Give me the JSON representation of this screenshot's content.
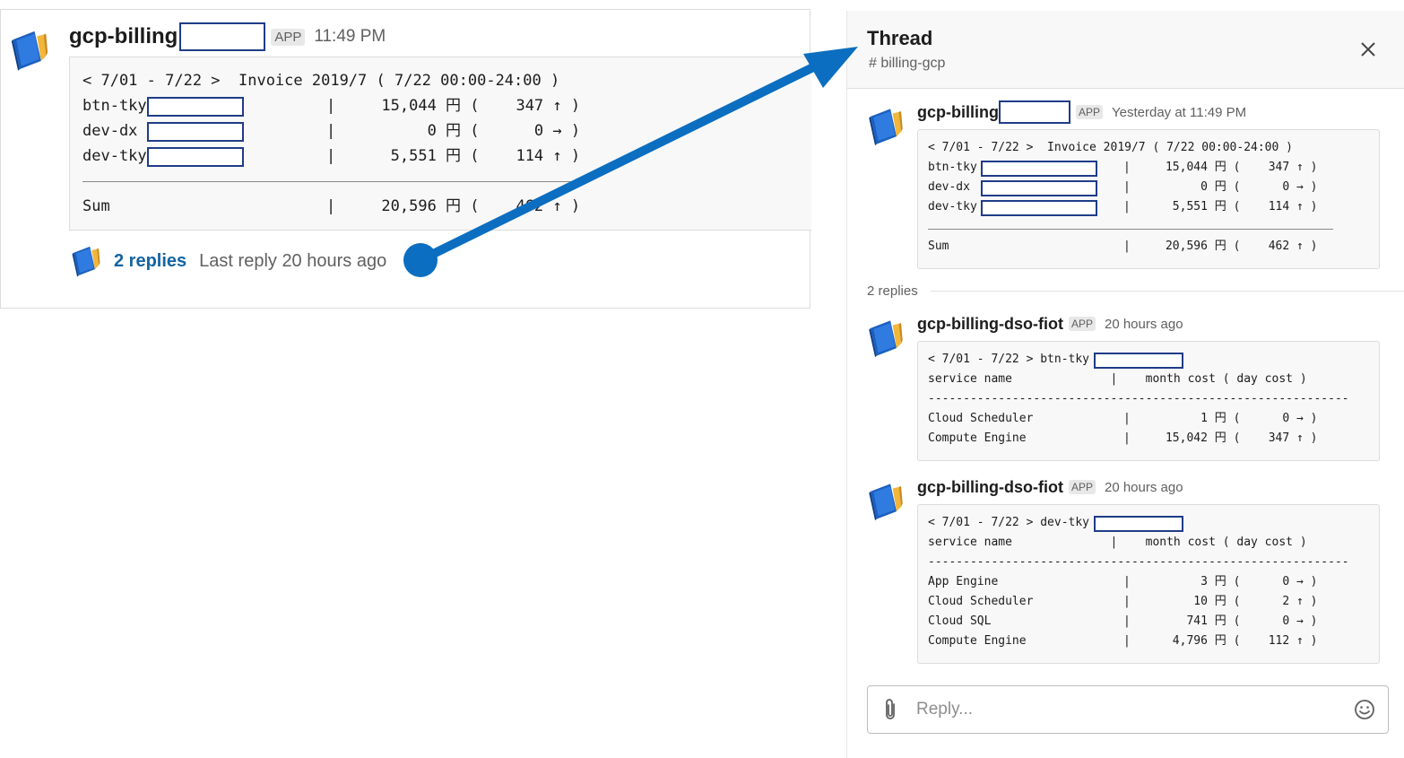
{
  "colors": {
    "accent_link": "#1264a3",
    "redaction_border": "#1f3c88",
    "annotation_arrow": "#0b6ec0"
  },
  "left_message": {
    "bot_name": "gcp-billing",
    "badge": "APP",
    "time": "11:49 PM",
    "code": {
      "header": "< 7/01 - 7/22 >  Invoice 2019/7 ( 7/22 00:00-24:00 )",
      "rows": [
        {
          "name": "btn-tky",
          "cost": "|     15,044 円 (    347 ↑ )"
        },
        {
          "name": "dev-dx",
          "cost": "|          0 円 (      0 → )"
        },
        {
          "name": "dev-tky",
          "cost": "|      5,551 円 (    114 ↑ )"
        }
      ],
      "sum_name": "Sum",
      "sum_cost": "|     20,596 円 (    462 ↑ )"
    },
    "replies_link": "2 replies",
    "last_reply": "Last reply 20 hours ago"
  },
  "thread": {
    "title": "Thread",
    "channel": "# billing-gcp",
    "close_icon": "close-icon",
    "parent": {
      "bot_name": "gcp-billing",
      "badge": "APP",
      "time": "Yesterday at 11:49 PM",
      "header": "< 7/01 - 7/22 >  Invoice 2019/7 ( 7/22 00:00-24:00 )",
      "rows": [
        {
          "name": "btn-tky",
          "cost": "|     15,044 円 (    347 ↑ )"
        },
        {
          "name": "dev-dx",
          "cost": "|          0 円 (      0 → )"
        },
        {
          "name": "dev-tky",
          "cost": "|      5,551 円 (    114 ↑ )"
        }
      ],
      "sum_name": "Sum",
      "sum_cost": "|     20,596 円 (    462 ↑ )"
    },
    "replies_count": "2 replies",
    "reply1": {
      "bot_name": "gcp-billing-dso-fiot",
      "badge": "APP",
      "time": "20 hours ago",
      "header": "< 7/01 - 7/22 > btn-tky",
      "columns": "service name              |    month cost ( day cost )",
      "separator": "------------------------------------------------------------",
      "rows": [
        {
          "name": "Cloud Scheduler",
          "cost": "|          1 円 (      0 → )"
        },
        {
          "name": "Compute Engine",
          "cost": "|     15,042 円 (    347 ↑ )"
        }
      ]
    },
    "reply2": {
      "bot_name": "gcp-billing-dso-fiot",
      "badge": "APP",
      "time": "20 hours ago",
      "header": "< 7/01 - 7/22 > dev-tky",
      "columns": "service name              |    month cost ( day cost )",
      "separator": "------------------------------------------------------------",
      "rows": [
        {
          "name": "App Engine",
          "cost": "|          3 円 (      0 → )"
        },
        {
          "name": "Cloud Scheduler",
          "cost": "|         10 円 (      2 ↑ )"
        },
        {
          "name": "Cloud SQL",
          "cost": "|        741 円 (      0 → )"
        },
        {
          "name": "Compute Engine",
          "cost": "|      4,796 円 (    112 ↑ )"
        }
      ]
    },
    "reply_box": {
      "placeholder": "Reply...",
      "attach_icon": "paperclip-icon",
      "emoji_icon": "smiley-icon"
    }
  }
}
